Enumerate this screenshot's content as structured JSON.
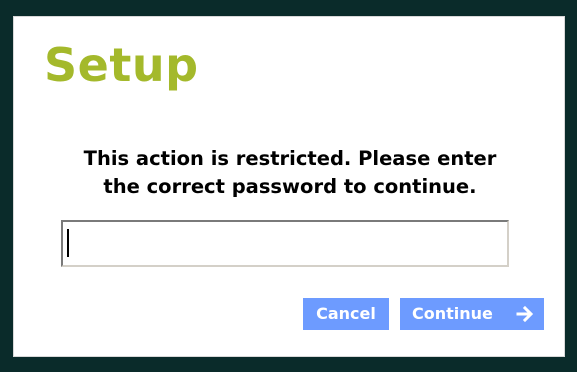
{
  "dialog": {
    "title": "Setup",
    "message_line1": "This action is restricted.  Please enter",
    "message_line2": "the correct password to continue.",
    "password": {
      "value": "",
      "placeholder": ""
    },
    "buttons": {
      "cancel_label": "Cancel",
      "continue_label": "Continue",
      "continue_icon": "arrow-right-icon"
    }
  },
  "colors": {
    "background": "#0a2b2a",
    "title": "#a4b92b",
    "button": "#6d9bff",
    "button_text": "#ffffff"
  }
}
